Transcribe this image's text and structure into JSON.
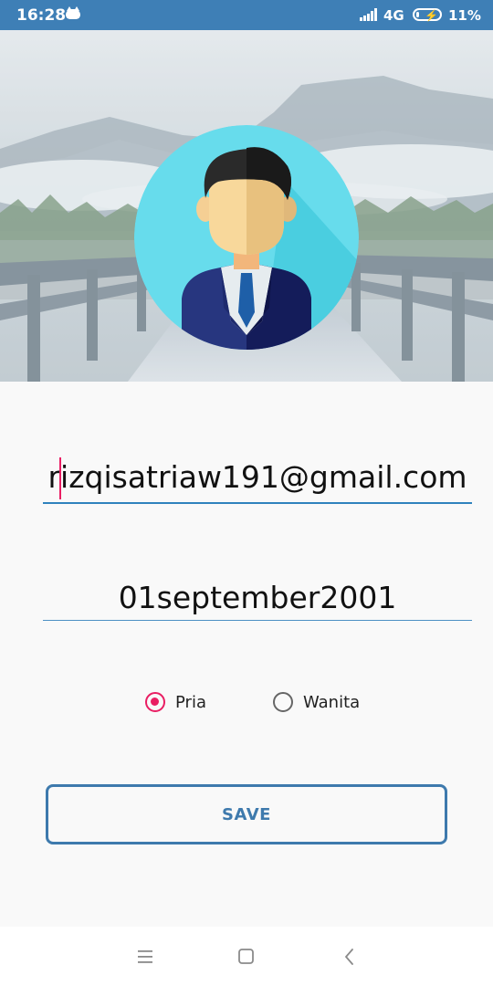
{
  "status_bar": {
    "time": "16:28",
    "network": "4G",
    "battery_percent": "11%",
    "battery_level": 0.11,
    "icons": [
      "cat-notification-icon",
      "signal-icon",
      "battery-charging-icon"
    ]
  },
  "header": {
    "background": "mountain-bridge-photo",
    "avatar": "businessman-avatar"
  },
  "form": {
    "email_value": "rizqisatriaw191@gmail.com",
    "birthdate_value": "01september2001",
    "gender_options": [
      {
        "label": "Pria",
        "selected": true
      },
      {
        "label": "Wanita",
        "selected": false
      }
    ],
    "save_label": "SAVE"
  },
  "colors": {
    "status_bar": "#3e7fb6",
    "accent": "#e91e63",
    "underline": "#2f82bd",
    "button": "#3e7aad"
  },
  "nav_bar": {
    "icons": [
      "menu-icon",
      "home-square-icon",
      "back-icon"
    ]
  }
}
